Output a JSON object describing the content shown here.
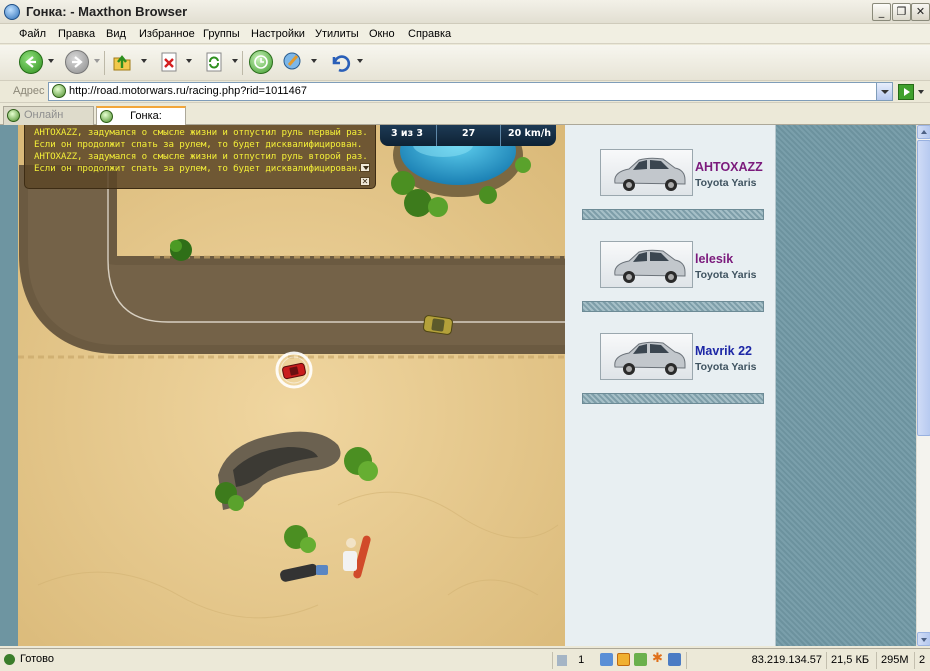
{
  "window": {
    "title": "Гонка: - Maxthon Browser"
  },
  "menu": [
    "Файл",
    "Правка",
    "Вид",
    "Избранное",
    "Группы",
    "Настройки",
    "Утилиты",
    "Окно",
    "Справка"
  ],
  "address": {
    "label": "Адрес",
    "url": "http://road.motorwars.ru/racing.php?rid=1011467"
  },
  "tabs": [
    {
      "label": "Онлайн игра..."
    },
    {
      "label": "Гонка:"
    }
  ],
  "chat": {
    "lines": [
      "AHTOXAZZ, задумался о смысле жизни и отпустил руль первый раз.",
      "Если он продолжит спать за рулем, то будет дисквалифицирован.",
      "AHTOXAZZ, задумался о смысле жизни и отпустил руль второй раз.",
      "Если он продолжит спать за рулем, то будет дисквалифицирован."
    ]
  },
  "hud": {
    "lap": "3 из 3",
    "time": "27",
    "speed": "20 km/h"
  },
  "players": [
    {
      "name": "AHTOXAZZ",
      "car": "Toyota Yaris",
      "color": "#7b1a7c"
    },
    {
      "name": "lelesik",
      "car": "Toyota Yaris",
      "color": "#7b1a7c"
    },
    {
      "name": "Mavrik 22",
      "car": "Toyota Yaris",
      "color": "#1c27a6"
    }
  ],
  "status": {
    "text": "Готово",
    "count": "1",
    "ip": "83.219.134.57",
    "size": "21,5 КБ",
    "memory": "295M",
    "tabs": "2"
  }
}
